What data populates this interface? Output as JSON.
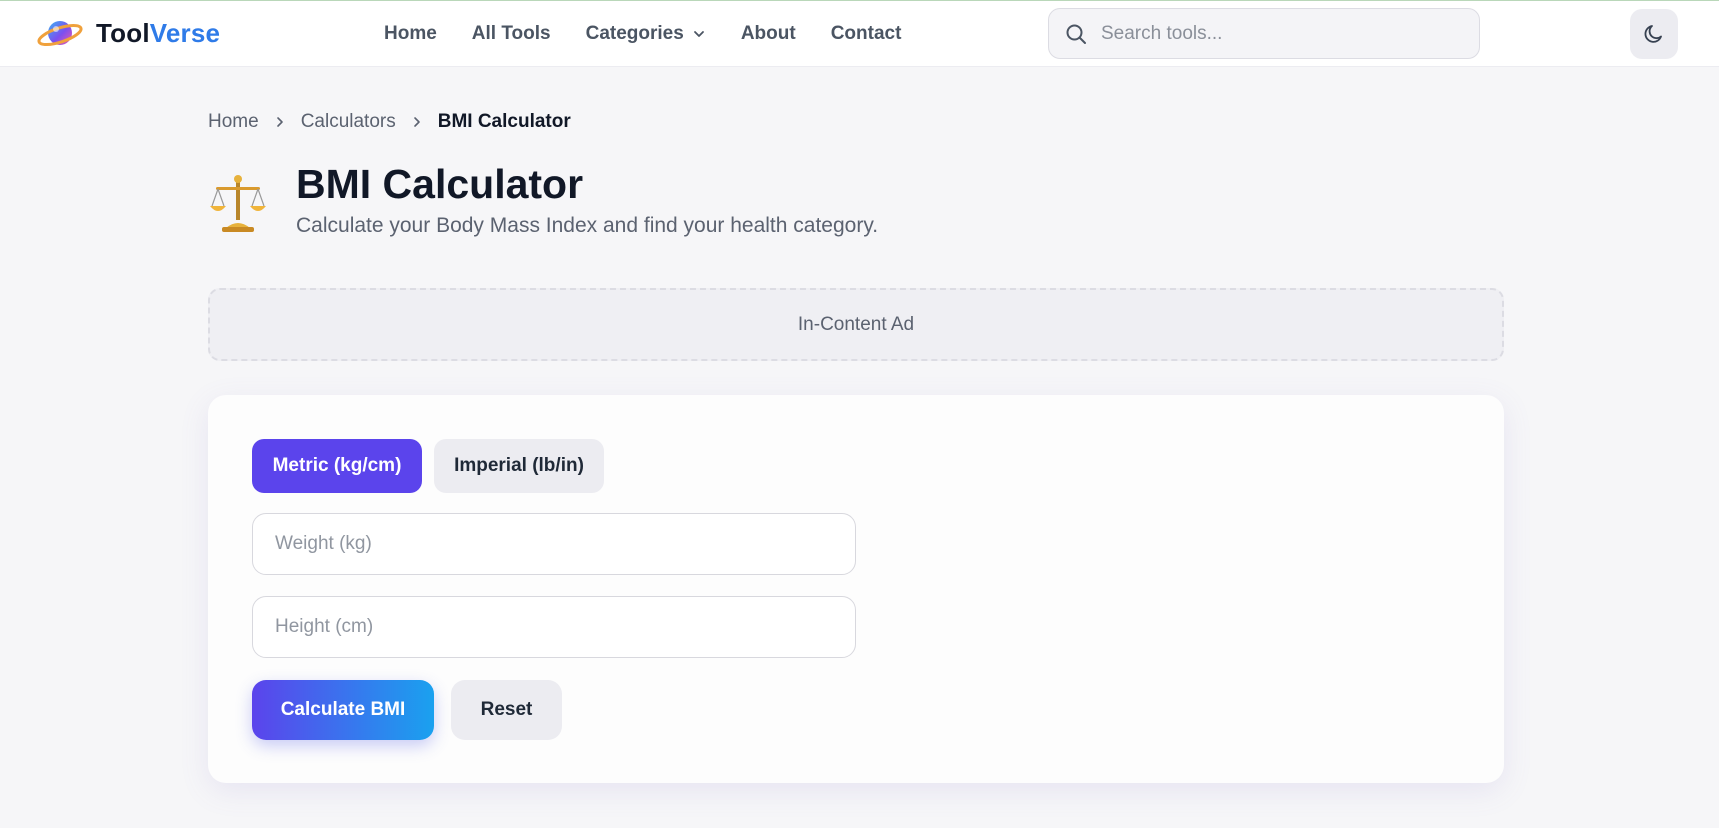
{
  "header": {
    "logo": {
      "part1": "Tool",
      "part2": "Verse"
    },
    "nav": [
      {
        "label": "Home"
      },
      {
        "label": "All Tools"
      },
      {
        "label": "Categories"
      },
      {
        "label": "About"
      },
      {
        "label": "Contact"
      }
    ],
    "search": {
      "placeholder": "Search tools..."
    },
    "theme_toggle_icon": "moon-icon"
  },
  "breadcrumb": [
    "Home",
    "Calculators",
    "BMI Calculator"
  ],
  "page": {
    "icon": "balance-scale-icon",
    "title": "BMI Calculator",
    "subtitle": "Calculate your Body Mass Index and find your health category."
  },
  "ad": {
    "label": "In-Content Ad"
  },
  "calculator": {
    "unit_toggle": {
      "metric": "Metric (kg/cm)",
      "imperial": "Imperial (lb/in)",
      "selected": "metric"
    },
    "weight": {
      "placeholder": "Weight (kg)",
      "value": ""
    },
    "height": {
      "placeholder": "Height (cm)",
      "value": ""
    },
    "calculate_label": "Calculate BMI",
    "reset_label": "Reset"
  },
  "colors": {
    "accent": "#5b44ec",
    "gradient_end": "#1aa1ef",
    "logo_accent": "#2f7be8",
    "background": "#f6f6f8"
  }
}
